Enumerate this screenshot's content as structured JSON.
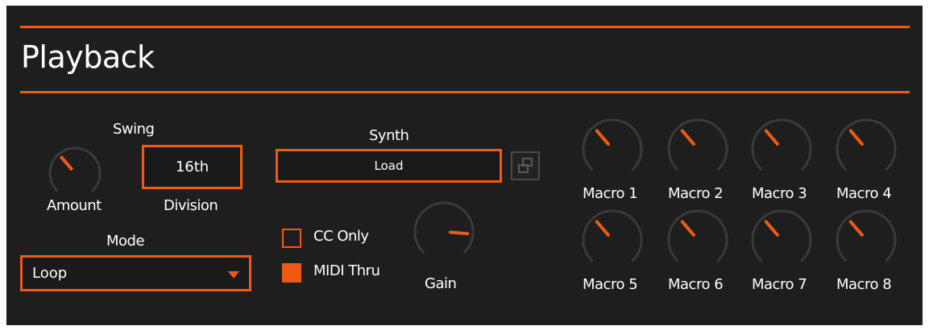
{
  "header": {
    "title": "Playback"
  },
  "swing": {
    "label": "Swing",
    "amount_label": "Amount",
    "amount_level": 0.35,
    "division_label": "Division",
    "division_value": "16th"
  },
  "mode": {
    "label": "Mode",
    "value": "Loop",
    "arrow_icon": "dropdown-triangle-icon"
  },
  "synth": {
    "label": "Synth",
    "value": "Load",
    "link_icon": "duplicate-window-icon"
  },
  "options": {
    "cc_only": {
      "label": "CC Only",
      "checked": false
    },
    "midi_thru": {
      "label": "MIDI Thru",
      "checked": true
    }
  },
  "gain": {
    "label": "Gain",
    "level": 0.85
  },
  "macros": [
    {
      "label": "Macro 1",
      "level": 0.35
    },
    {
      "label": "Macro 2",
      "level": 0.35
    },
    {
      "label": "Macro 3",
      "level": 0.35
    },
    {
      "label": "Macro 4",
      "level": 0.35
    },
    {
      "label": "Macro 5",
      "level": 0.35
    },
    {
      "label": "Macro 6",
      "level": 0.35
    },
    {
      "label": "Macro 7",
      "level": 0.35
    },
    {
      "label": "Macro 8",
      "level": 0.35
    }
  ],
  "colors": {
    "accent": "#f05a10",
    "panel": "#1e1e1e",
    "knob_track": "#3a3a3a"
  }
}
